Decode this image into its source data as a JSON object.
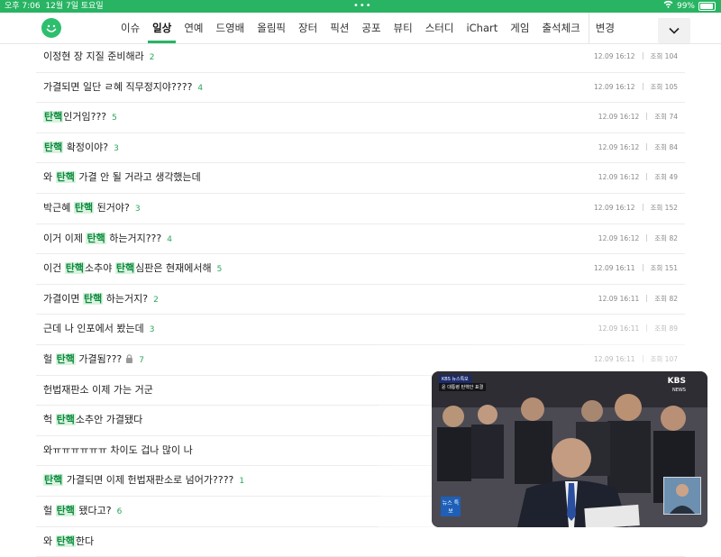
{
  "status_bar": {
    "time": "오후 7:06",
    "date": "12월 7일 토요일",
    "dots": "•••",
    "battery": "99%",
    "bg_color": "#28b463"
  },
  "nav": {
    "logo_icon": "smiley-logo-icon",
    "tabs": [
      {
        "label": "이슈",
        "active": false
      },
      {
        "label": "일상",
        "active": true
      },
      {
        "label": "연예",
        "active": false
      },
      {
        "label": "드영배",
        "active": false
      },
      {
        "label": "올림픽",
        "active": false
      },
      {
        "label": "장터",
        "active": false
      },
      {
        "label": "픽션",
        "active": false
      },
      {
        "label": "공포",
        "active": false
      },
      {
        "label": "뷰티",
        "active": false
      },
      {
        "label": "스터디",
        "active": false
      },
      {
        "label": "iChart",
        "active": false
      },
      {
        "label": "게임",
        "active": false
      },
      {
        "label": "출석체크",
        "active": false
      },
      {
        "label": "변경",
        "active": false
      }
    ],
    "dropdown_icon": "chevron-down-icon",
    "accent_color": "#28b463"
  },
  "posts": [
    {
      "parts": [
        {
          "t": "이정현 장 지질 준비해라",
          "h": false
        }
      ],
      "count": "2",
      "time": "12.09 16:12",
      "views": "조회 104",
      "locked": false
    },
    {
      "parts": [
        {
          "t": "가결되면 일단 ㄹ혜 직무정지야????",
          "h": false
        }
      ],
      "count": "4",
      "time": "12.09 16:12",
      "views": "조회 105",
      "locked": false
    },
    {
      "parts": [
        {
          "t": "탄핵",
          "h": true
        },
        {
          "t": "인거임???",
          "h": false
        }
      ],
      "count": "5",
      "time": "12.09 16:12",
      "views": "조회 74",
      "locked": false
    },
    {
      "parts": [
        {
          "t": "탄핵",
          "h": true
        },
        {
          "t": " 확정이야?",
          "h": false
        }
      ],
      "count": "3",
      "time": "12.09 16:12",
      "views": "조회 84",
      "locked": false
    },
    {
      "parts": [
        {
          "t": "와 ",
          "h": false
        },
        {
          "t": "탄핵",
          "h": true
        },
        {
          "t": " 가결 안 될 거라고 생각했는데",
          "h": false
        }
      ],
      "count": "",
      "time": "12.09 16:12",
      "views": "조회 49",
      "locked": false
    },
    {
      "parts": [
        {
          "t": "박근혜 ",
          "h": false
        },
        {
          "t": "탄핵",
          "h": true
        },
        {
          "t": " 된거야?",
          "h": false
        }
      ],
      "count": "3",
      "time": "12.09 16:12",
      "views": "조회 152",
      "locked": false
    },
    {
      "parts": [
        {
          "t": "이거 이제 ",
          "h": false
        },
        {
          "t": "탄핵",
          "h": true
        },
        {
          "t": " 하는거지???",
          "h": false
        }
      ],
      "count": "4",
      "time": "12.09 16:12",
      "views": "조회 82",
      "locked": false
    },
    {
      "parts": [
        {
          "t": "이건 ",
          "h": false
        },
        {
          "t": "탄핵",
          "h": true
        },
        {
          "t": "소추야 ",
          "h": false
        },
        {
          "t": "탄핵",
          "h": true
        },
        {
          "t": "심판은 현재에서해",
          "h": false
        }
      ],
      "count": "5",
      "time": "12.09 16:11",
      "views": "조회 151",
      "locked": false
    },
    {
      "parts": [
        {
          "t": "가결이면 ",
          "h": false
        },
        {
          "t": "탄핵",
          "h": true
        },
        {
          "t": " 하는거지?",
          "h": false
        }
      ],
      "count": "2",
      "time": "12.09 16:11",
      "views": "조회 82",
      "locked": false
    },
    {
      "parts": [
        {
          "t": "근데 나 인포에서 봤는데",
          "h": false
        }
      ],
      "count": "3",
      "time": "12.09 16:11",
      "views": "조회 89",
      "locked": false
    },
    {
      "parts": [
        {
          "t": "헐 ",
          "h": false
        },
        {
          "t": "탄핵",
          "h": true
        },
        {
          "t": " 가결됨???",
          "h": false
        }
      ],
      "count": "7",
      "time": "12.09 16:11",
      "views": "조회 107",
      "locked": true
    },
    {
      "parts": [
        {
          "t": "헌법재판소 이제 가는 거군",
          "h": false
        }
      ],
      "count": "",
      "time": "",
      "views": "",
      "locked": false
    },
    {
      "parts": [
        {
          "t": "헉 ",
          "h": false
        },
        {
          "t": "탄핵",
          "h": true
        },
        {
          "t": "소추안 가결됐다",
          "h": false
        }
      ],
      "count": "",
      "time": "",
      "views": "",
      "locked": false
    },
    {
      "parts": [
        {
          "t": "와ㅠㅠㅠㅠㅠㅠ 차이도 겁나 많이 나",
          "h": false
        }
      ],
      "count": "",
      "time": "",
      "views": "",
      "locked": false
    },
    {
      "parts": [
        {
          "t": "탄핵",
          "h": true
        },
        {
          "t": " 가결되면 이제 헌법재판소로 넘어가????",
          "h": false
        }
      ],
      "count": "1",
      "time": "",
      "views": "",
      "locked": false
    },
    {
      "parts": [
        {
          "t": "헐 ",
          "h": false
        },
        {
          "t": "탄핵",
          "h": true
        },
        {
          "t": " 됐다고?",
          "h": false
        }
      ],
      "count": "6",
      "time": "",
      "views": "",
      "locked": false
    },
    {
      "parts": [
        {
          "t": "와 ",
          "h": false
        },
        {
          "t": "탄핵",
          "h": true
        },
        {
          "t": "한다",
          "h": false
        }
      ],
      "count": "",
      "time": "",
      "views": "",
      "locked": false
    }
  ],
  "video": {
    "network": "KBS",
    "network_sub": "NEWS",
    "tag": "KBS 뉴스특보",
    "headline": "윤 대통령 탄핵안 표결",
    "badge": "뉴스 특보"
  }
}
